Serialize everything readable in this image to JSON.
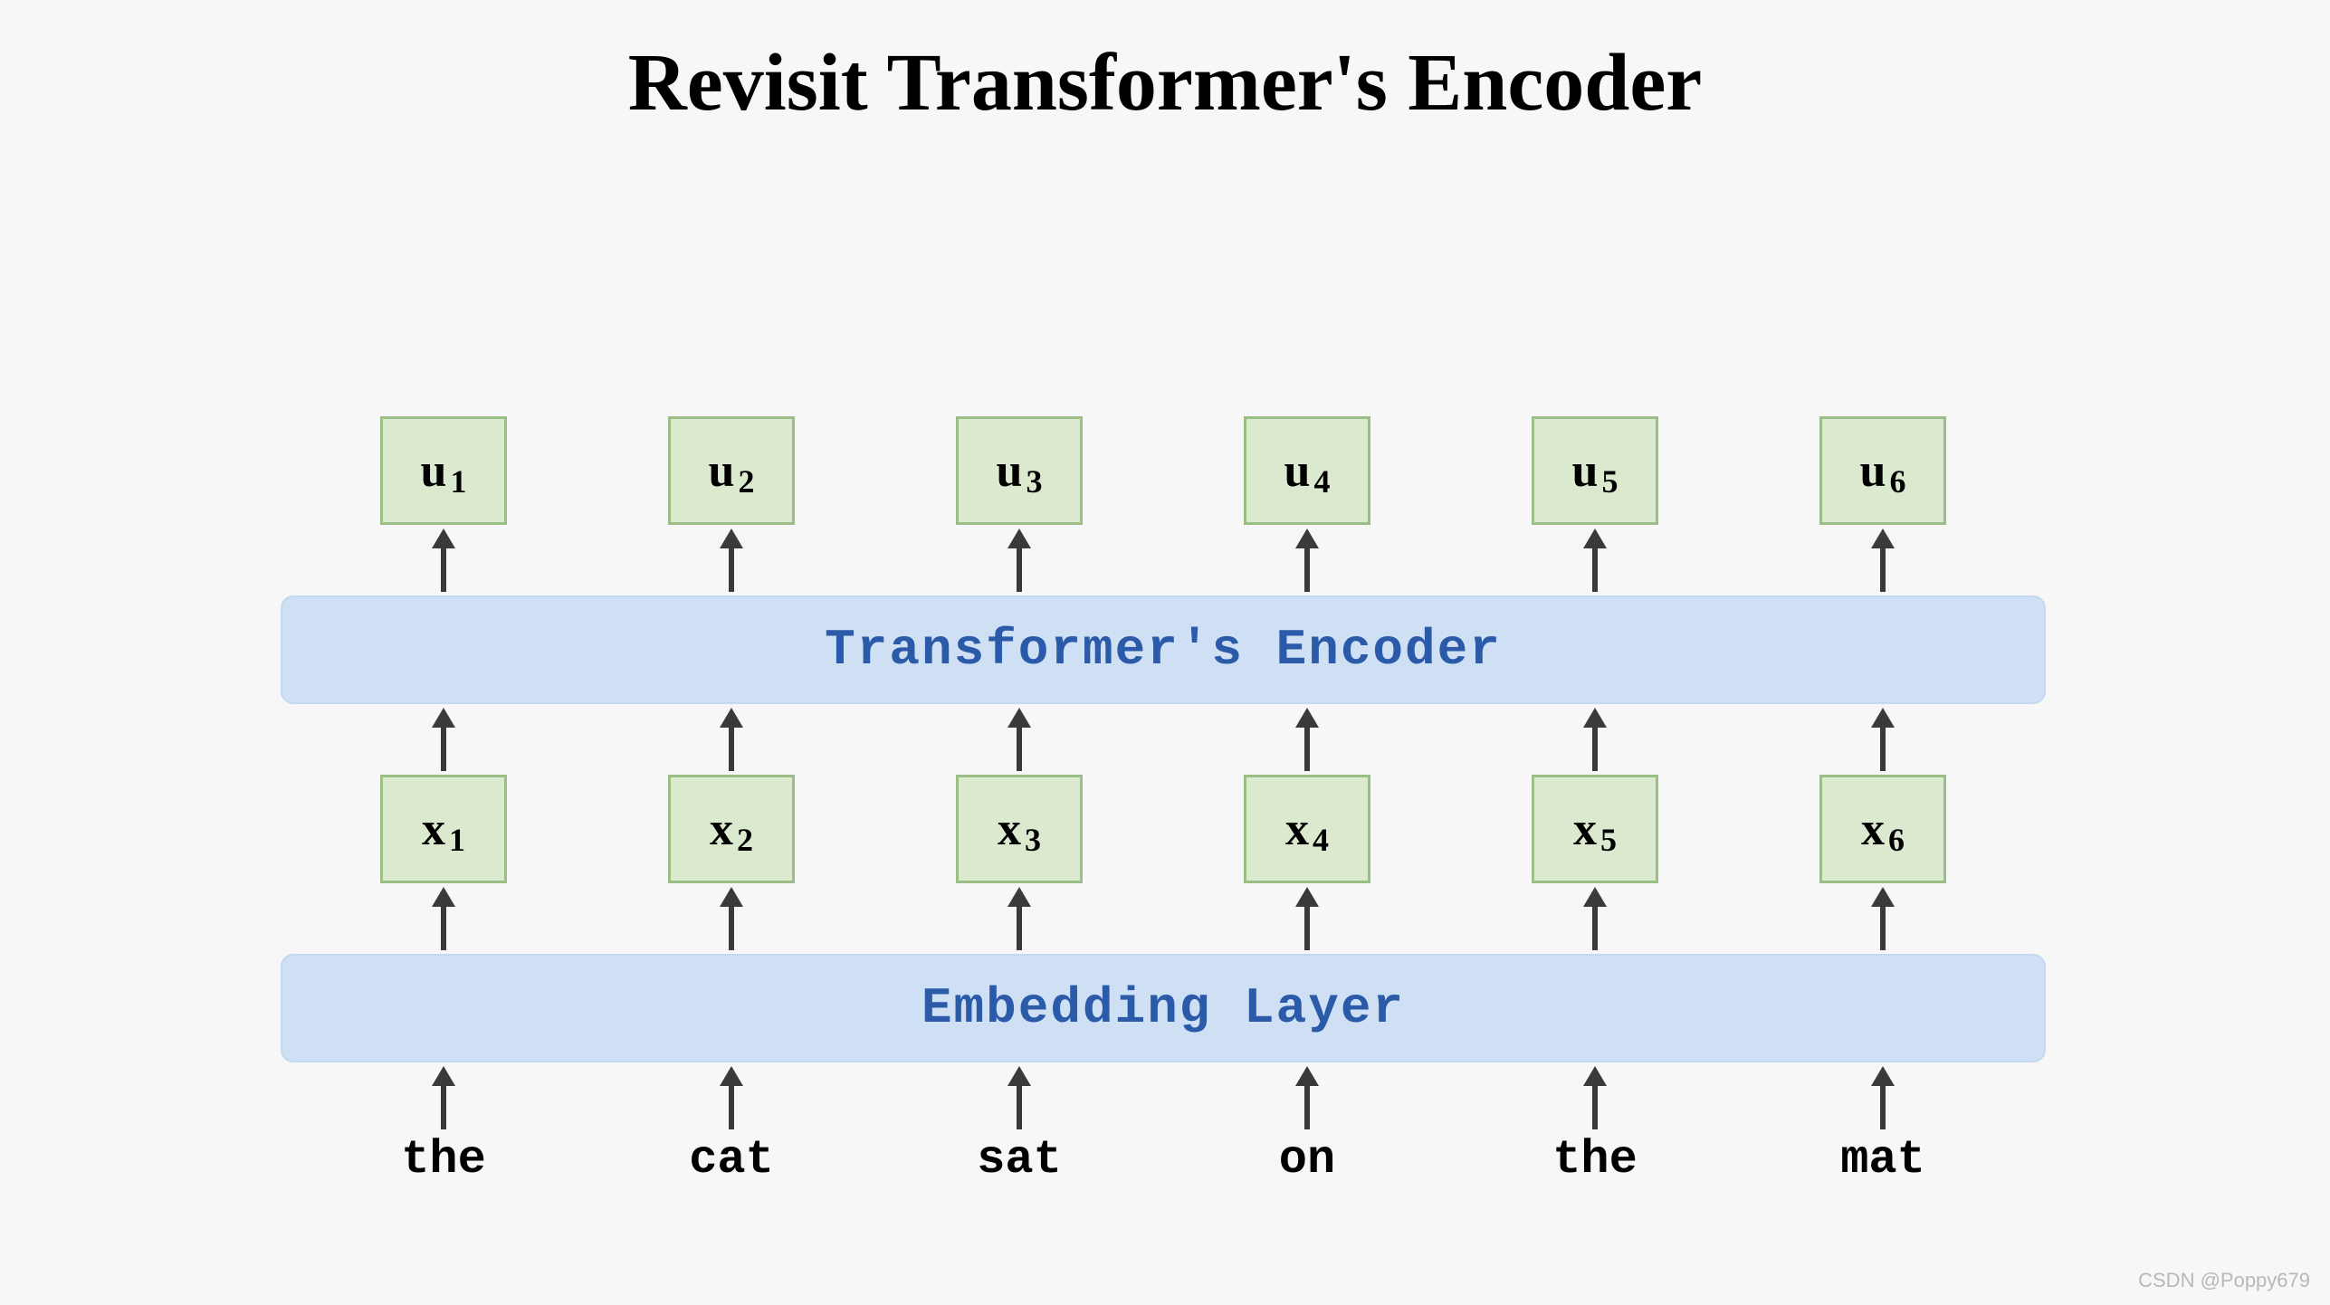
{
  "title": "Revisit Transformer's Encoder",
  "outputs": [
    {
      "base": "u",
      "sub": "1"
    },
    {
      "base": "u",
      "sub": "2"
    },
    {
      "base": "u",
      "sub": "3"
    },
    {
      "base": "u",
      "sub": "4"
    },
    {
      "base": "u",
      "sub": "5"
    },
    {
      "base": "u",
      "sub": "6"
    }
  ],
  "encoder_label": "Transformer's Encoder",
  "embeddings": [
    {
      "base": "x",
      "sub": "1"
    },
    {
      "base": "x",
      "sub": "2"
    },
    {
      "base": "x",
      "sub": "3"
    },
    {
      "base": "x",
      "sub": "4"
    },
    {
      "base": "x",
      "sub": "5"
    },
    {
      "base": "x",
      "sub": "6"
    }
  ],
  "embedding_label": "Embedding Layer",
  "words": [
    "the",
    "cat",
    "sat",
    "on",
    "the",
    "mat"
  ],
  "watermark": "CSDN @Poppy679"
}
